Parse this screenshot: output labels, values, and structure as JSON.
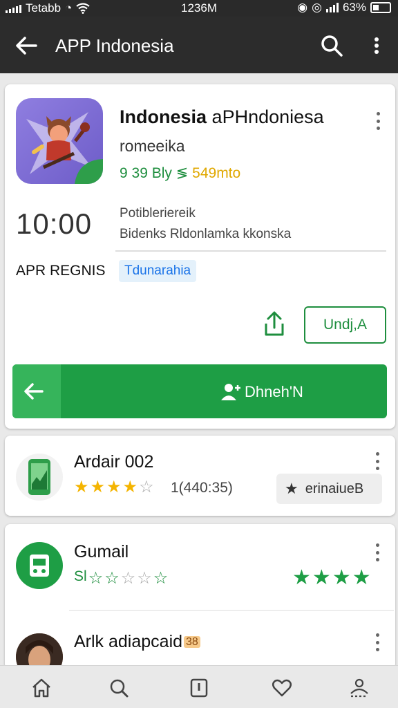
{
  "status": {
    "carrier": "Tetabb",
    "time": "1236M",
    "battery": "63%"
  },
  "appbar": {
    "title": "APP Indonesia"
  },
  "app": {
    "name_bold": "Indonesia",
    "name_rest": "aPHndoniesa",
    "developer": "romeeika",
    "meta_green": "9 39 Bly",
    "meta_sep": " ≶ ",
    "meta_yellow": "549mto",
    "time_display": "10:00",
    "desc_line1": "Potibleriereik",
    "desc_line2": "Bidenks Rldonlamka kkonska",
    "label": "APR REGNIS",
    "chip": "Tdunarahia",
    "outline_button": "Undj,A",
    "primary_button": "Dhneh'N"
  },
  "list": [
    {
      "title": "Ardair 002",
      "rating": 4,
      "count": "1(440:35)",
      "button": "erinaiueB"
    },
    {
      "title": "Gumail",
      "subtitle": "Sl"
    },
    {
      "title": "Arlk adiapcaid",
      "badge": "38"
    }
  ],
  "colors": {
    "green": "#1e9e45",
    "accent_text": "#1e8e3e",
    "star": "#f4b400",
    "chip_bg": "#e4f1fb",
    "appbar": "#2c2c2c"
  },
  "nav_icons": [
    "home-icon",
    "search-icon",
    "apps-icon",
    "wishlist-icon",
    "account-icon"
  ]
}
